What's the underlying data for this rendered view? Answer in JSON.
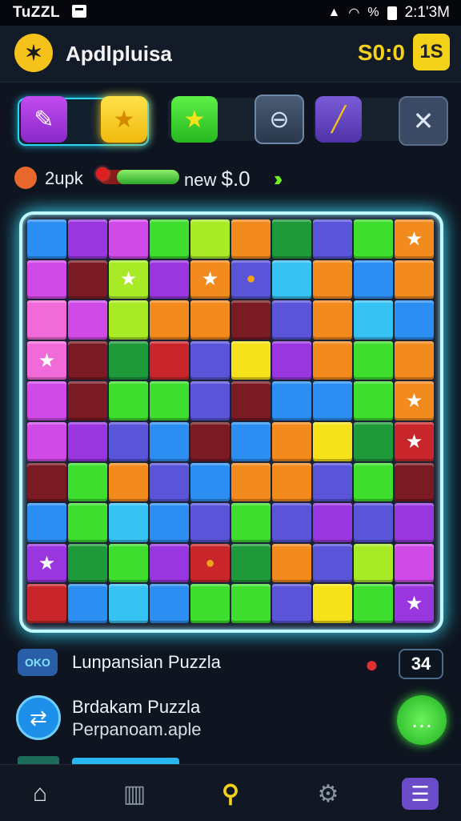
{
  "status_bar": {
    "carrier": "TuZZL",
    "time": "2:1'3M",
    "battery_label": "%"
  },
  "header": {
    "title": "Apdlpluisa",
    "score": "S0:0",
    "level": "1S"
  },
  "tools": {
    "icons": [
      "puzzle-icon",
      "star-icon",
      "star-piece-icon",
      "briefcase-icon",
      "pencil-icon",
      "close-icon"
    ]
  },
  "progress": {
    "pack_label": "2upk",
    "new_label": "new",
    "new_value": "$.0",
    "bar_fill_fraction": 0.78
  },
  "board": {
    "colors": {
      "purple": "#9a36e0",
      "magenta": "#d04ae8",
      "pink": "#f06ad8",
      "green": "#3ede2e",
      "lime": "#a8ea26",
      "orange": "#f28a1e",
      "yellow": "#f6e21a",
      "blue": "#2c8ef2",
      "cyan": "#36c2f2",
      "red": "#c8262a",
      "darkred": "#7a1a22",
      "dkgreen": "#1f9a3a",
      "indigo": "#5a54d8"
    }
  },
  "list": {
    "row1_icon_text": "OKO",
    "row1_title": "Lunpansian Puzzla",
    "row1_count": "34",
    "row2_title": "Brdakam Puzzla",
    "row2_subtitle": "Perpanoam.aple"
  },
  "nav": {
    "items": [
      "home-icon",
      "trash-icon",
      "search-icon",
      "settings-icon",
      "menu-icon"
    ]
  }
}
